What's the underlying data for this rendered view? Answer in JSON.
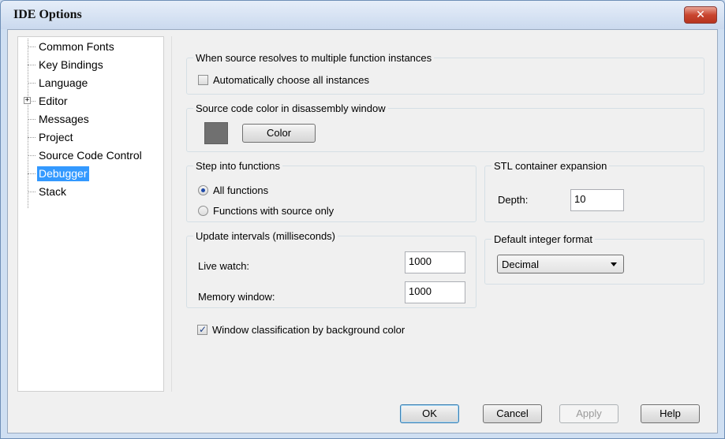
{
  "window": {
    "title": "IDE Options",
    "close_icon": "close-icon"
  },
  "tree": {
    "items": [
      {
        "label": "Common Fonts"
      },
      {
        "label": "Key Bindings"
      },
      {
        "label": "Language"
      },
      {
        "label": "Editor",
        "expander": "+"
      },
      {
        "label": "Messages"
      },
      {
        "label": "Project"
      },
      {
        "label": "Source Code Control"
      },
      {
        "label": "Debugger",
        "selected": true
      },
      {
        "label": "Stack"
      }
    ]
  },
  "panel": {
    "multi_instances": {
      "title": "When source resolves to multiple function instances",
      "auto_choose": {
        "label": "Automatically choose all instances",
        "checked": false
      }
    },
    "source_color": {
      "title": "Source code color in disassembly window",
      "color_button": "Color",
      "swatch_color": "#707070"
    },
    "step_into": {
      "title": "Step into functions",
      "options": [
        {
          "label": "All functions",
          "selected": true
        },
        {
          "label": "Functions with source only",
          "selected": false
        }
      ]
    },
    "stl": {
      "title": "STL container expansion",
      "depth_label": "Depth:",
      "depth_value": "10"
    },
    "update_intervals": {
      "title": "Update intervals (milliseconds)",
      "live_watch_label": "Live watch:",
      "live_watch_value": "1000",
      "memory_window_label": "Memory window:",
      "memory_window_value": "1000"
    },
    "integer_format": {
      "title": "Default integer format",
      "selected": "Decimal"
    },
    "window_classification": {
      "label": "Window classification by background color",
      "checked": true
    }
  },
  "footer": {
    "ok": "OK",
    "cancel": "Cancel",
    "apply": "Apply",
    "help": "Help"
  },
  "glyphs": {
    "check": "✓",
    "expand": "+",
    "close": "✕"
  }
}
